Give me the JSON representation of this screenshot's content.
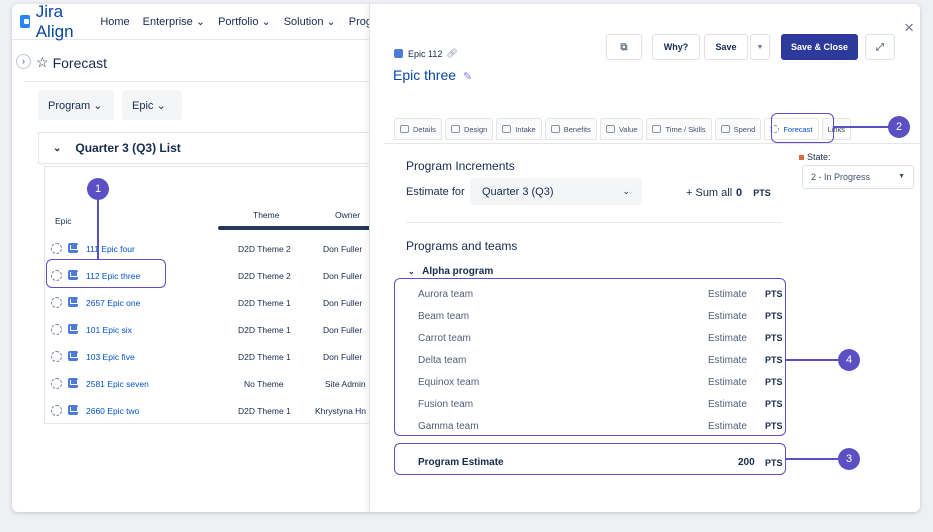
{
  "topnav": {
    "logo": "Jira Align",
    "items": [
      "Home",
      "Enterprise ⌄",
      "Portfolio ⌄",
      "Solution ⌄",
      "Prog"
    ]
  },
  "page": {
    "title": "Forecast",
    "filters": [
      "Program ⌄",
      "Epic ⌄"
    ],
    "quarter_list": "Quarter 3 (Q3) List"
  },
  "table": {
    "headers": {
      "epic": "Epic",
      "theme": "Theme",
      "owner": "Owner"
    },
    "rows": [
      {
        "epic": "111 Epic four",
        "theme": "D2D Theme 2",
        "owner": "Don Fuller"
      },
      {
        "epic": "112 Epic three",
        "theme": "D2D Theme 2",
        "owner": "Don Fuller"
      },
      {
        "epic": "2657 Epic one",
        "theme": "D2D Theme 1",
        "owner": "Don Fuller"
      },
      {
        "epic": "101 Epic six",
        "theme": "D2D Theme 1",
        "owner": "Don Fuller"
      },
      {
        "epic": "103 Epic five",
        "theme": "D2D Theme 1",
        "owner": "Don Fuller"
      },
      {
        "epic": "2581 Epic seven",
        "theme": "No Theme",
        "owner": "Site Admin"
      },
      {
        "epic": "2660 Epic two",
        "theme": "D2D Theme 1",
        "owner": "Khrystyna Hn"
      }
    ]
  },
  "panel": {
    "epic_ref": "Epic 112",
    "epic_name": "Epic three",
    "toolbar": {
      "why": "Why?",
      "save": "Save",
      "save_close": "Save & Close"
    },
    "tabs": [
      "Details",
      "Design",
      "Intake",
      "Benefits",
      "Value",
      "Time / Skills",
      "Spend",
      "Forecast",
      "Links"
    ],
    "program_increments": "Program Increments",
    "estimate_for": "Estimate for",
    "estimate_value": "Quarter 3 (Q3)",
    "sum_all": "+ Sum all",
    "sum_value": "0",
    "pts": "PTS",
    "state_label": "State:",
    "state_value": "2 - In Progress",
    "programs_and_teams": "Programs and teams",
    "program_name": "Alpha program",
    "teams": [
      "Aurora team",
      "Beam team",
      "Carrot team",
      "Delta team",
      "Equinox team",
      "Fusion team",
      "Gamma team"
    ],
    "estimate_placeholder": "Estimate",
    "program_estimate_label": "Program Estimate",
    "program_estimate_value": "200"
  },
  "callouts": [
    "1",
    "2",
    "3",
    "4"
  ],
  "colors": {
    "accent": "#5b4fc4",
    "primary_button": "#2d3a9b",
    "link": "#0052cc"
  }
}
